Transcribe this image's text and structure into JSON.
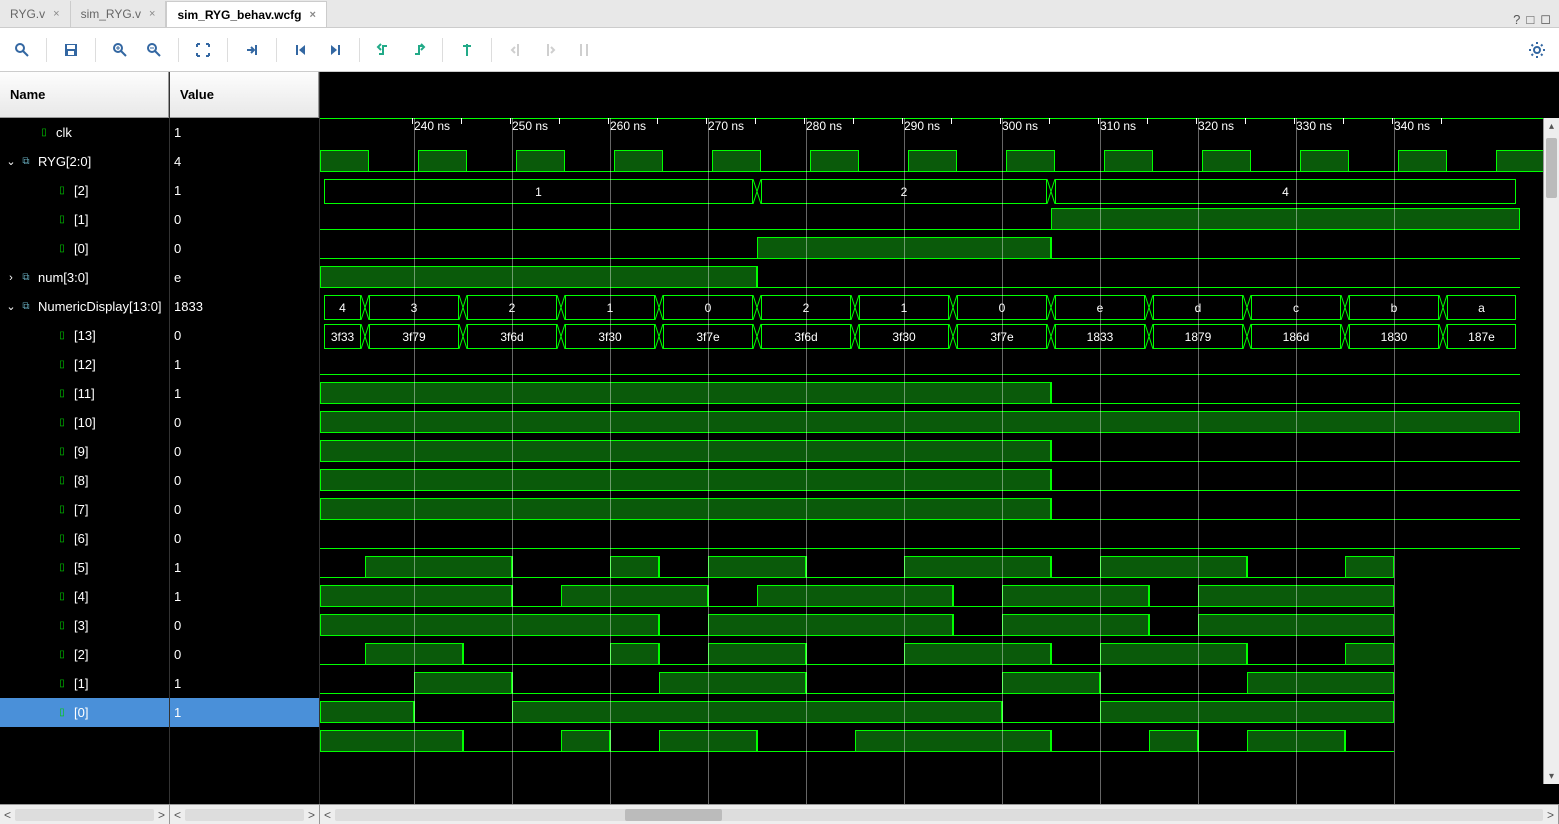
{
  "tabs": [
    {
      "label": "RYG.v",
      "active": false
    },
    {
      "label": "sim_RYG.v",
      "active": false
    },
    {
      "label": "sim_RYG_behav.wcfg",
      "active": true
    }
  ],
  "columns": {
    "name": "Name",
    "value": "Value"
  },
  "time_ticks": [
    {
      "pos": 94,
      "label": "240 ns"
    },
    {
      "pos": 192,
      "label": "250 ns"
    },
    {
      "pos": 290,
      "label": "260 ns"
    },
    {
      "pos": 388,
      "label": "270 ns"
    },
    {
      "pos": 486,
      "label": "280 ns"
    },
    {
      "pos": 584,
      "label": "290 ns"
    },
    {
      "pos": 682,
      "label": "300 ns"
    },
    {
      "pos": 780,
      "label": "310 ns"
    },
    {
      "pos": 878,
      "label": "320 ns"
    },
    {
      "pos": 976,
      "label": "330 ns"
    },
    {
      "pos": 1074,
      "label": "340 ns"
    }
  ],
  "signals": [
    {
      "name": "clk",
      "value": "1",
      "indent": 1,
      "type": "clk",
      "expander": ""
    },
    {
      "name": "RYG[2:0]",
      "value": "4",
      "indent": 0,
      "type": "bus",
      "expander": "v"
    },
    {
      "name": "[2]",
      "value": "1",
      "indent": 2,
      "type": "bit",
      "expander": ""
    },
    {
      "name": "[1]",
      "value": "0",
      "indent": 2,
      "type": "bit",
      "expander": ""
    },
    {
      "name": "[0]",
      "value": "0",
      "indent": 2,
      "type": "bit",
      "expander": ""
    },
    {
      "name": "num[3:0]",
      "value": "e",
      "indent": 0,
      "type": "bus",
      "expander": ">"
    },
    {
      "name": "NumericDisplay[13:0]",
      "value": "1833",
      "indent": 0,
      "type": "bus",
      "expander": "v"
    },
    {
      "name": "[13]",
      "value": "0",
      "indent": 2,
      "type": "bit",
      "expander": ""
    },
    {
      "name": "[12]",
      "value": "1",
      "indent": 2,
      "type": "bit",
      "expander": ""
    },
    {
      "name": "[11]",
      "value": "1",
      "indent": 2,
      "type": "bit",
      "expander": ""
    },
    {
      "name": "[10]",
      "value": "0",
      "indent": 2,
      "type": "bit",
      "expander": ""
    },
    {
      "name": "[9]",
      "value": "0",
      "indent": 2,
      "type": "bit",
      "expander": ""
    },
    {
      "name": "[8]",
      "value": "0",
      "indent": 2,
      "type": "bit",
      "expander": ""
    },
    {
      "name": "[7]",
      "value": "0",
      "indent": 2,
      "type": "bit",
      "expander": ""
    },
    {
      "name": "[6]",
      "value": "0",
      "indent": 2,
      "type": "bit",
      "expander": ""
    },
    {
      "name": "[5]",
      "value": "1",
      "indent": 2,
      "type": "bit",
      "expander": ""
    },
    {
      "name": "[4]",
      "value": "1",
      "indent": 2,
      "type": "bit",
      "expander": ""
    },
    {
      "name": "[3]",
      "value": "0",
      "indent": 2,
      "type": "bit",
      "expander": ""
    },
    {
      "name": "[2]",
      "value": "0",
      "indent": 2,
      "type": "bit",
      "expander": ""
    },
    {
      "name": "[1]",
      "value": "1",
      "indent": 2,
      "type": "bit",
      "expander": ""
    },
    {
      "name": "[0]",
      "value": "1",
      "indent": 2,
      "type": "bit",
      "expander": "",
      "selected": true
    }
  ],
  "waves": {
    "clk_period": 98,
    "clk_start": -49,
    "ryg_bus": [
      {
        "from": 0,
        "to": 437,
        "label": "1"
      },
      {
        "from": 437,
        "to": 731,
        "label": "2"
      },
      {
        "from": 731,
        "to": 1200,
        "label": "4"
      }
    ],
    "ryg2": [
      {
        "from": 0,
        "to": 731,
        "v": 0
      },
      {
        "from": 731,
        "to": 1200,
        "v": 1
      }
    ],
    "ryg1": [
      {
        "from": 0,
        "to": 437,
        "v": 0
      },
      {
        "from": 437,
        "to": 731,
        "v": 1
      },
      {
        "from": 731,
        "to": 1200,
        "v": 0
      }
    ],
    "ryg0": [
      {
        "from": 0,
        "to": 437,
        "v": 1
      },
      {
        "from": 437,
        "to": 1200,
        "v": 0
      }
    ],
    "num_bus": [
      {
        "from": 0,
        "to": 45,
        "label": "4"
      },
      {
        "from": 45,
        "to": 143,
        "label": "3"
      },
      {
        "from": 143,
        "to": 241,
        "label": "2"
      },
      {
        "from": 241,
        "to": 339,
        "label": "1"
      },
      {
        "from": 339,
        "to": 437,
        "label": "0"
      },
      {
        "from": 437,
        "to": 535,
        "label": "2"
      },
      {
        "from": 535,
        "to": 633,
        "label": "1"
      },
      {
        "from": 633,
        "to": 731,
        "label": "0"
      },
      {
        "from": 731,
        "to": 829,
        "label": "e"
      },
      {
        "from": 829,
        "to": 927,
        "label": "d"
      },
      {
        "from": 927,
        "to": 1025,
        "label": "c"
      },
      {
        "from": 1025,
        "to": 1123,
        "label": "b"
      },
      {
        "from": 1123,
        "to": 1200,
        "label": "a"
      }
    ],
    "disp_bus": [
      {
        "from": 0,
        "to": 45,
        "label": "3f33"
      },
      {
        "from": 45,
        "to": 143,
        "label": "3f79"
      },
      {
        "from": 143,
        "to": 241,
        "label": "3f6d"
      },
      {
        "from": 241,
        "to": 339,
        "label": "3f30"
      },
      {
        "from": 339,
        "to": 437,
        "label": "3f7e"
      },
      {
        "from": 437,
        "to": 535,
        "label": "3f6d"
      },
      {
        "from": 535,
        "to": 633,
        "label": "3f30"
      },
      {
        "from": 633,
        "to": 731,
        "label": "3f7e"
      },
      {
        "from": 731,
        "to": 829,
        "label": "1833"
      },
      {
        "from": 829,
        "to": 927,
        "label": "1879"
      },
      {
        "from": 927,
        "to": 1025,
        "label": "186d"
      },
      {
        "from": 1025,
        "to": 1123,
        "label": "1830"
      },
      {
        "from": 1123,
        "to": 1200,
        "label": "187e"
      }
    ],
    "b13": [
      {
        "from": 0,
        "to": 1200,
        "v": 0
      }
    ],
    "b12": [
      {
        "from": 0,
        "to": 731,
        "v": 1
      },
      {
        "from": 731,
        "to": 1200,
        "v": 0
      }
    ],
    "b11": [
      {
        "from": 0,
        "to": 1200,
        "v": 1
      }
    ],
    "b10": [
      {
        "from": 0,
        "to": 731,
        "v": 1
      },
      {
        "from": 731,
        "to": 1200,
        "v": 0
      }
    ],
    "b9": [
      {
        "from": 0,
        "to": 731,
        "v": 1
      },
      {
        "from": 731,
        "to": 1200,
        "v": 0
      }
    ],
    "b8": [
      {
        "from": 0,
        "to": 731,
        "v": 1
      },
      {
        "from": 731,
        "to": 1200,
        "v": 0
      }
    ],
    "b7": [
      {
        "from": 0,
        "to": 1200,
        "v": 0
      }
    ],
    "b6_pattern": "0111001011001110111001",
    "b5_pattern": "1111011101111011101111",
    "b4_pattern": "1111111011111011101111",
    "b3_pattern": "0110001011001110111001",
    "b2_pattern": "0011000111000011000111",
    "b1_pattern": "1100111111111100111111",
    "b0_pattern": "1110010110011110010110"
  }
}
